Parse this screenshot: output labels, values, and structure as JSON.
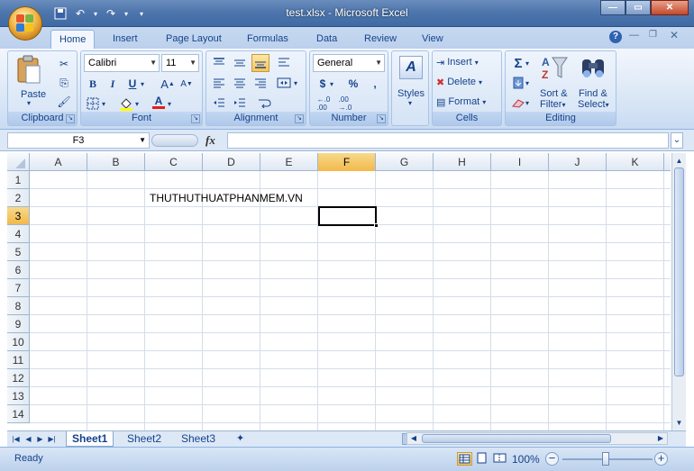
{
  "window": {
    "title": "test.xlsx - Microsoft Excel"
  },
  "tabs": [
    "Home",
    "Insert",
    "Page Layout",
    "Formulas",
    "Data",
    "Review",
    "View"
  ],
  "font": {
    "name": "Calibri",
    "size": "11"
  },
  "number_format": "General",
  "groups": {
    "clipboard": "Clipboard",
    "font": "Font",
    "alignment": "Alignment",
    "number": "Number",
    "cells": "Cells",
    "editing": "Editing"
  },
  "buttons": {
    "paste": "Paste",
    "styles": "Styles",
    "insert": "Insert",
    "delete": "Delete",
    "format": "Format",
    "sort_filter_1": "Sort &",
    "sort_filter_2": "Filter",
    "find_select_1": "Find &",
    "find_select_2": "Select",
    "bold": "B",
    "italic": "I",
    "underline": "U",
    "currency": "$",
    "percent": "%",
    "comma": ",",
    "fx": "fx"
  },
  "name_box": "F3",
  "columns": [
    "A",
    "B",
    "C",
    "D",
    "E",
    "F",
    "G",
    "H",
    "I",
    "J",
    "K"
  ],
  "rows": [
    "1",
    "2",
    "3",
    "4",
    "5",
    "6",
    "7",
    "8",
    "9",
    "10",
    "11",
    "12",
    "13",
    "14"
  ],
  "cells": {
    "C2": "THUTHUTHUATPHANMEM.VN"
  },
  "selected_cell": "F3",
  "sheets": [
    "Sheet1",
    "Sheet2",
    "Sheet3"
  ],
  "active_sheet": "Sheet1",
  "status": {
    "ready": "Ready",
    "zoom": "100%"
  }
}
